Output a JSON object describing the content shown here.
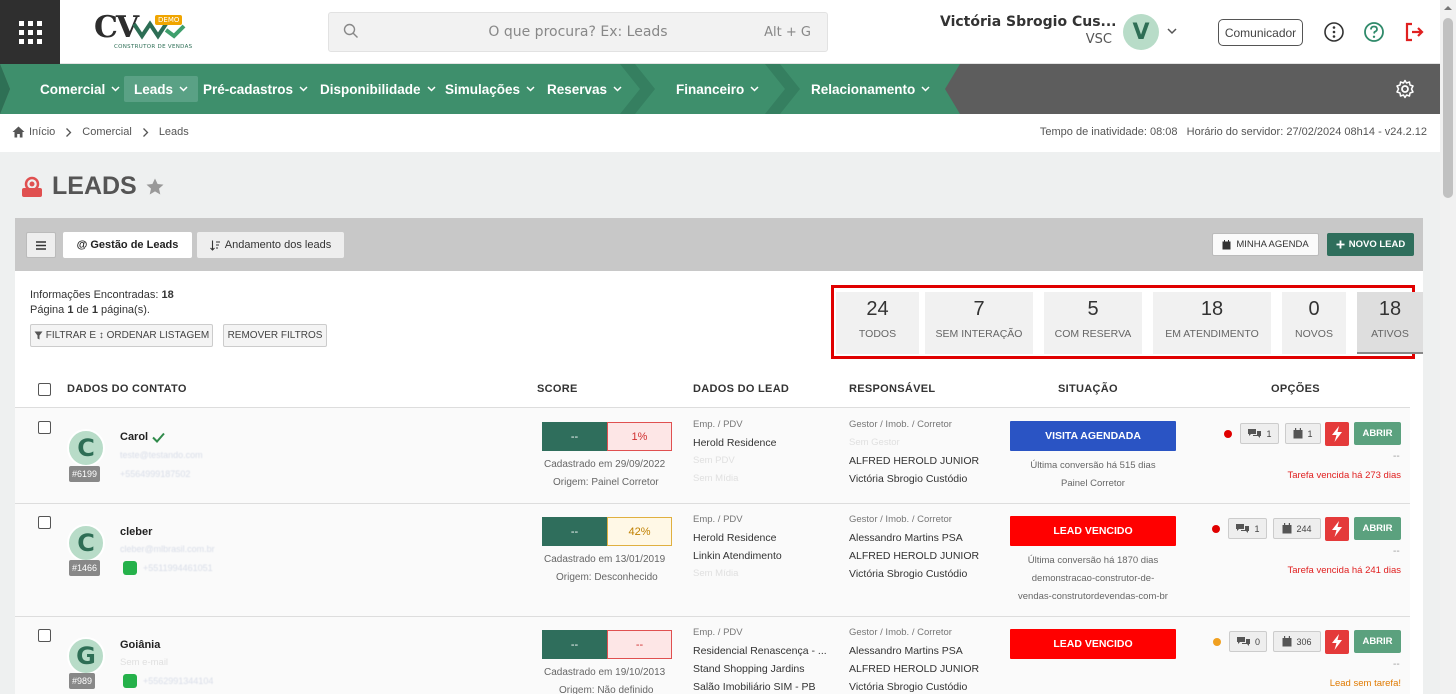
{
  "header": {
    "logo_text": "CV",
    "logo_badge": "DEMO",
    "logo_subtitle": "CONSTRUTOR DE VENDAS",
    "search_placeholder": "O que procura? Ex: Leads",
    "search_shortcut": "Alt + G",
    "user_name": "Victória Sbrogio Cus...",
    "user_org": "VSC",
    "avatar_letter": "V",
    "communicator_label": "Comunicador"
  },
  "nav": {
    "items": [
      {
        "label": "Comercial"
      },
      {
        "label": "Leads"
      },
      {
        "label": "Pré-cadastros"
      },
      {
        "label": "Disponibilidade"
      },
      {
        "label": "Simulações"
      },
      {
        "label": "Reservas"
      },
      {
        "label": "Financeiro"
      },
      {
        "label": "Relacionamento"
      }
    ],
    "active": "Leads"
  },
  "breadcrumb": {
    "home": "Início",
    "level1": "Comercial",
    "level2": "Leads",
    "server_info": "Tempo de inatividade: 08:08   Horário do servidor: 27/02/2024 08h14 - v24.2.12"
  },
  "page": {
    "title": "LEADS"
  },
  "toolbar": {
    "tab_gestao": "@ Gestão de Leads",
    "tab_andamento": "Andamento dos leads",
    "minha_agenda": "MINHA AGENDA",
    "novo_lead": "NOVO LEAD"
  },
  "summary": {
    "found_label": "Informações Encontradas:",
    "found_count": "18",
    "page_prefix": "Página",
    "page_current": "1",
    "page_of": "de",
    "page_total": "1",
    "page_suffix": "página(s).",
    "filter_button": "FILTRAR E ↕ ORDENAR LISTAGEM",
    "remove_filters": "REMOVER FILTROS"
  },
  "stats": [
    {
      "value": "24",
      "label": "TODOS"
    },
    {
      "value": "7",
      "label": "SEM INTERAÇÃO"
    },
    {
      "value": "5",
      "label": "COM RESERVA"
    },
    {
      "value": "18",
      "label": "EM ATENDIMENTO"
    },
    {
      "value": "0",
      "label": "NOVOS"
    },
    {
      "value": "18",
      "label": "ATIVOS"
    }
  ],
  "table": {
    "headers": [
      "DADOS DO CONTATO",
      "SCORE",
      "DADOS DO LEAD",
      "RESPONSÁVEL",
      "SITUAÇÃO",
      "OPÇÕES"
    ],
    "rows": [
      {
        "avatar_letter": "C",
        "id": "#6199",
        "name": "Carol",
        "email": "teste@testando.com",
        "phone": "+5564999187502",
        "score_a": "--",
        "score_b": "1%",
        "cadastrado": "Cadastrado em 29/09/2022",
        "origem": "Origem: Painel Corretor",
        "lead_label": "Emp. / PDV",
        "lead_lines": [
          "Herold Residence",
          "Sem PDV",
          "Sem Mídia"
        ],
        "resp_label": "Gestor / Imob. / Corretor",
        "resp_lines": [
          "Sem Gestor",
          "ALFRED HEROLD JUNIOR",
          "Victória Sbrogio Custódio"
        ],
        "situation": "VISITA AGENDADA",
        "situation_lines": [
          "Última conversão há 515 dias",
          "Painel Corretor"
        ],
        "chat_count": "1",
        "task_count": "1",
        "open_label": "ABRIR",
        "dash": "--",
        "task_text": "Tarefa vencida há 273 dias"
      },
      {
        "avatar_letter": "C",
        "id": "#1466",
        "name": "cleber",
        "email": "cleber@mlbrasil.com.br",
        "phone": "+5511994461051",
        "score_a": "--",
        "score_b": "42%",
        "cadastrado": "Cadastrado em 13/01/2019",
        "origem": "Origem: Desconhecido",
        "lead_label": "Emp. / PDV",
        "lead_lines": [
          "Herold Residence",
          "Linkin Atendimento",
          "Sem Mídia"
        ],
        "resp_label": "Gestor / Imob. / Corretor",
        "resp_lines": [
          "Alessandro Martins PSA",
          "ALFRED HEROLD JUNIOR",
          "Victória Sbrogio Custódio"
        ],
        "situation": "LEAD VENCIDO",
        "situation_lines": [
          "Última conversão há 1870 dias",
          "demonstracao-construtor-de-",
          "vendas-construtordevendas-com-br"
        ],
        "chat_count": "1",
        "task_count": "244",
        "open_label": "ABRIR",
        "dash": "--",
        "task_text": "Tarefa vencida há 241 dias"
      },
      {
        "avatar_letter": "G",
        "id": "#989",
        "name": "Goiânia",
        "email": "Sem e-mail",
        "phone": "+5562991344104",
        "score_a": "--",
        "score_b": "--",
        "cadastrado": "Cadastrado em 19/10/2013",
        "origem": "Origem: Não definido",
        "lead_label": "Emp. / PDV",
        "lead_lines": [
          "Residencial Renascença - ...",
          "Stand Shopping Jardins",
          "Salão Imobiliário SIM - PB"
        ],
        "resp_label": "Gestor / Imob. / Corretor",
        "resp_lines": [
          "Alessandro Martins PSA",
          "ALFRED HEROLD JUNIOR",
          "Victória Sbrogio Custódio"
        ],
        "situation": "LEAD VENCIDO",
        "situation_lines": [],
        "chat_count": "0",
        "task_count": "306",
        "open_label": "ABRIR",
        "dash": "--",
        "task_text": "Lead sem tarefa!"
      }
    ]
  },
  "colors": {
    "nav_green": "#3e8f6c",
    "nav_active": "#5aa185",
    "nav_gray": "#5d5d5d",
    "primary_dark": "#2f6e5c",
    "situation_blue": "#2a54c4",
    "situation_red": "#ff0000",
    "highlight_border": "#e00000"
  }
}
